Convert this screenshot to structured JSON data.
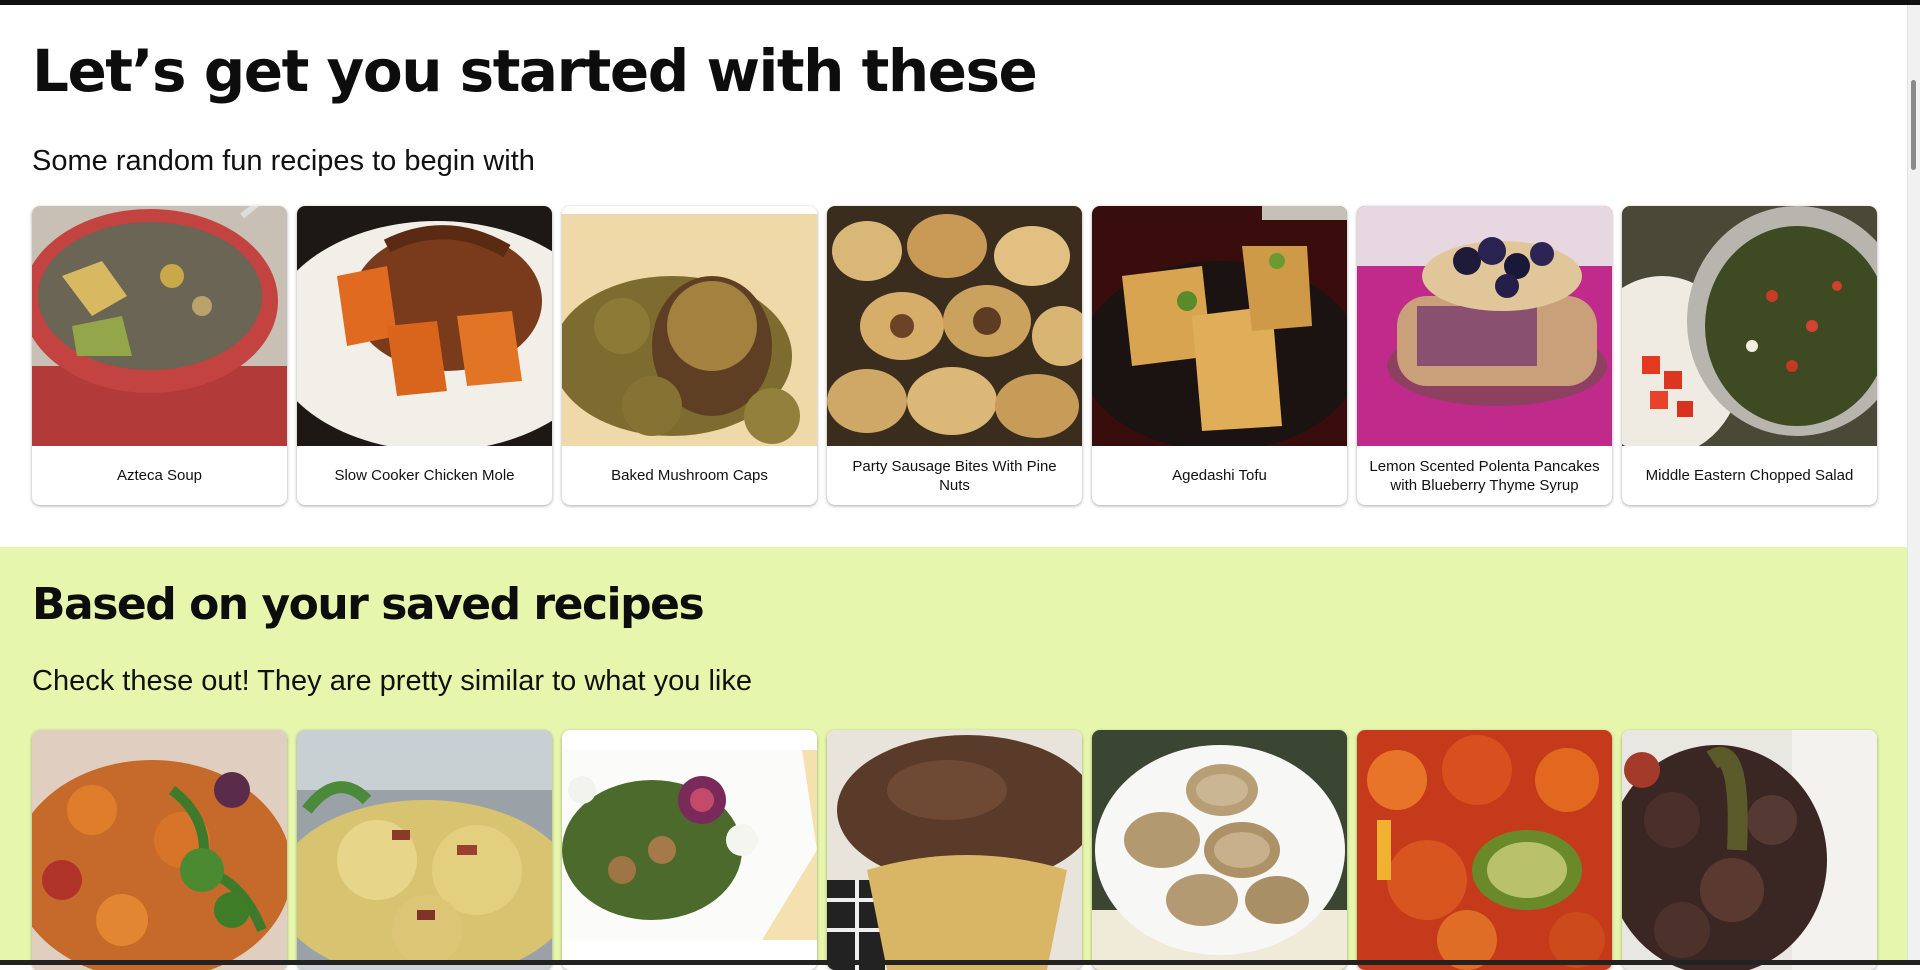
{
  "section_one": {
    "title": "Let’s get you started with these",
    "subtitle": "Some random fun recipes to begin with",
    "recipes": [
      {
        "name": "Azteca Soup",
        "image": "azteca-soup-photo"
      },
      {
        "name": "Slow Cooker Chicken Mole",
        "image": "chicken-mole-photo"
      },
      {
        "name": "Baked Mushroom Caps",
        "image": "mushroom-caps-photo"
      },
      {
        "name": "Party Sausage Bites With Pine Nuts",
        "image": "sausage-bites-photo"
      },
      {
        "name": "Agedashi Tofu",
        "image": "agedashi-tofu-photo"
      },
      {
        "name": "Lemon Scented Polenta Pancakes with Blueberry Thyme Syrup",
        "image": "polenta-pancakes-photo"
      },
      {
        "name": "Middle Eastern Chopped Salad",
        "image": "chopped-salad-photo"
      }
    ]
  },
  "section_two": {
    "title": "Based on your saved recipes",
    "subtitle": "Check these out! They are pretty similar to what you like",
    "recipes": [
      {
        "image": "roasted-squash-cilantro-photo"
      },
      {
        "image": "eggs-bacon-sauce-photo"
      },
      {
        "image": "fig-walnut-salad-photo"
      },
      {
        "image": "chocolate-cupcake-photo"
      },
      {
        "image": "sliced-bread-rounds-photo"
      },
      {
        "image": "ratatouille-photo"
      },
      {
        "image": "beef-stew-rice-photo"
      }
    ]
  },
  "colors": {
    "section_two_background": "#e6f7ad",
    "heading_text": "#0d0d0d"
  }
}
